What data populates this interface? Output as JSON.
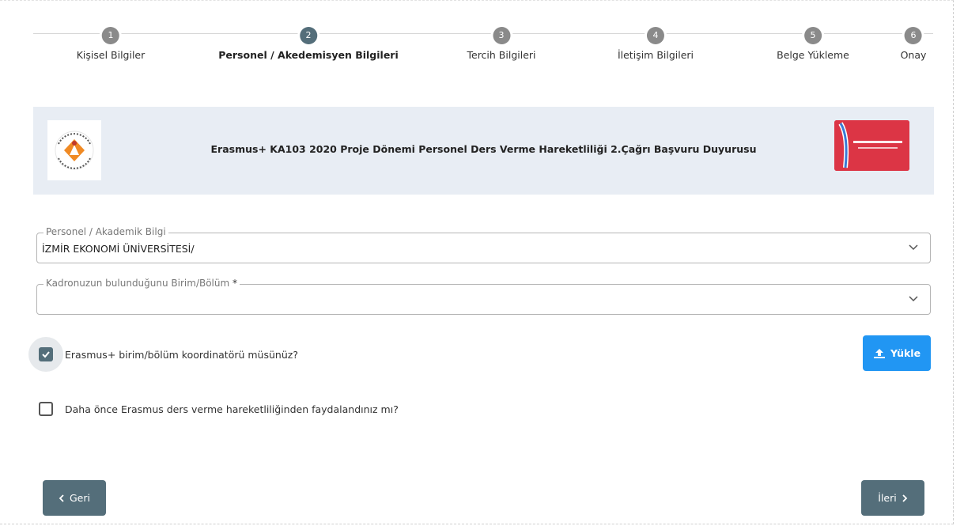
{
  "stepper": {
    "steps": [
      {
        "number": "1",
        "label": "Kişisel Bilgiler"
      },
      {
        "number": "2",
        "label": "Personel / Akedemisyen Bilgileri"
      },
      {
        "number": "3",
        "label": "Tercih Bilgileri"
      },
      {
        "number": "4",
        "label": "İletişim Bilgileri"
      },
      {
        "number": "5",
        "label": "Belge Yükleme"
      },
      {
        "number": "6",
        "label": "Onay"
      }
    ],
    "active_step": 2
  },
  "banner": {
    "title": "Erasmus+ KA103 2020 Proje Dönemi Personel Ders Verme Hareketliliği 2.Çağrı Başvuru Duyurusu",
    "left_logo_text": "İZMİR EKONOMİ ÜNİVERSİTESİ",
    "right_logo_line1": "TÜRKİYE ULUSAL AJANSI",
    "right_logo_line2": "TURKISH NATIONAL AGENCY"
  },
  "form": {
    "personnel_field": {
      "label": "Personel / Akademik Bilgi",
      "value": "İZMİR EKONOMİ ÜNİVERSİTESİ/"
    },
    "department_field": {
      "label": "Kadronuzun bulunduğunu Birim/Bölüm",
      "required_mark": "*",
      "value": ""
    },
    "coordinator_checkbox": {
      "label": "Erasmus+ birim/bölüm koordinatörü müsünüz?",
      "checked": true
    },
    "previous_mobility_checkbox": {
      "label": "Daha önce Erasmus ders verme hareketliliğinden faydalandınız mı?",
      "checked": false
    },
    "upload_label": "Yükle"
  },
  "nav": {
    "back_label": "Geri",
    "next_label": "İleri"
  },
  "colors": {
    "primary": "#546e7a",
    "upload": "#2196f3",
    "banner_bg": "#e8edf4",
    "agency_red": "#dc3545"
  }
}
